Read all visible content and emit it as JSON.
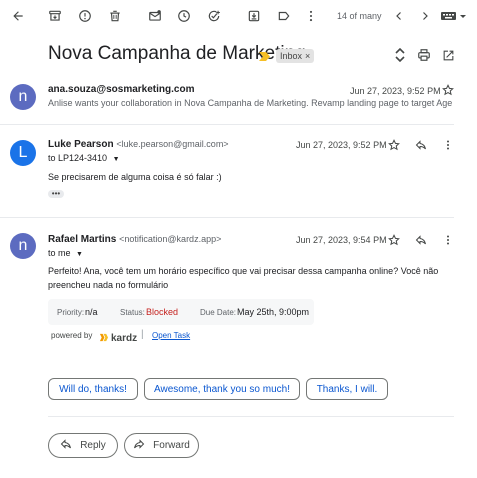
{
  "toolbar": {
    "pagination": "14 of many"
  },
  "thread": {
    "subject": "Nova Campanha de Marketing",
    "label": "Inbox",
    "label_remove": "×"
  },
  "messages": [
    {
      "avatar_letter": "n",
      "avatar_color": "#5c6bc0",
      "sender": "ana.souza@sosmarketing.com",
      "date": "Jun 27, 2023, 9:52 PM",
      "snippet": "Anlise wants your collaboration in Nova Campanha de Marketing. Revamp landing page to target Age..."
    },
    {
      "avatar_letter": "L",
      "avatar_color": "#1a73e8",
      "sender": "Luke Pearson",
      "sender_email": "<luke.pearson@gmail.com>",
      "to": "to LP124-3410",
      "date": "Jun 27, 2023, 9:52 PM",
      "body": "Se precisarem de alguma coisa é só falar :)",
      "more": "•••"
    },
    {
      "avatar_letter": "n",
      "avatar_color": "#5c6bc0",
      "sender": "Rafael Martins",
      "sender_email": "<notification@kardz.app>",
      "to": "to me",
      "date": "Jun 27, 2023, 9:54 PM",
      "body_line1": "Perfeito! Ana, você tem um horário específico que vai precisar dessa campanha online? Você não",
      "body_line2": "preencheu nada no formulário",
      "card": {
        "priority_label": "Priority:",
        "priority_value": "n/a",
        "status_label": "Status:",
        "status_value": "Blocked",
        "status_color": "#c5221f",
        "due_label": "Due Date:",
        "due_value": "May 25th, 9:00pm"
      },
      "powered_by": "powered by",
      "brand": "kardz",
      "brand_color": "#f29900",
      "separator": "|",
      "open_task": "Open Task"
    }
  ],
  "smart_replies": [
    "Will do, thanks!",
    "Awesome, thank you so much!",
    "Thanks, I will."
  ],
  "actions": {
    "reply": "Reply",
    "forward": "Forward"
  },
  "colors": {
    "link_blue": "#0b57d0",
    "important_marker": "#f6bf26"
  }
}
